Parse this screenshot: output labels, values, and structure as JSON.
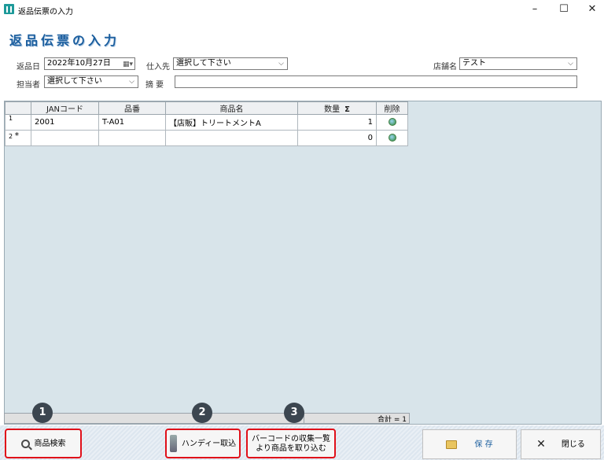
{
  "window": {
    "title": "返品伝票の入力",
    "minimize": "–",
    "maximize": "☐",
    "close": "✕"
  },
  "heading": "返品伝票の入力",
  "form": {
    "return_date_label": "返品日",
    "return_date_value": "2022年10月27日",
    "supplier_label": "仕入先",
    "supplier_value": "選択して下さい",
    "store_label": "店舗名",
    "store_value": "テスト",
    "staff_label": "担当者",
    "staff_value": "選択して下さい",
    "memo_label": "摘 要",
    "memo_value": ""
  },
  "grid": {
    "columns": [
      "JANコード",
      "品番",
      "商品名",
      "数量",
      "Σ",
      "削除"
    ],
    "rows": [
      {
        "no": "1",
        "marker": "",
        "jan": "2001",
        "code": "T-A01",
        "name": "【店販】トリートメントA",
        "qty": "1"
      },
      {
        "no": "2",
        "marker": "*",
        "jan": "",
        "code": "",
        "name": "",
        "qty": "0"
      }
    ]
  },
  "total_label": "合計 = 1",
  "buttons": {
    "search": "商品検索",
    "handy": "ハンディー取込",
    "barcode_line1": "バーコードの収集一覧",
    "barcode_line2": "より商品を取り込む",
    "save": "保 存",
    "close": "閉じる"
  },
  "badges": [
    "1",
    "2",
    "3"
  ],
  "colors": {
    "heading": "#1b5e9e",
    "delete_header": "#e00000",
    "highlight": "#e0101a",
    "grid_bg": "#d8e4ea"
  }
}
